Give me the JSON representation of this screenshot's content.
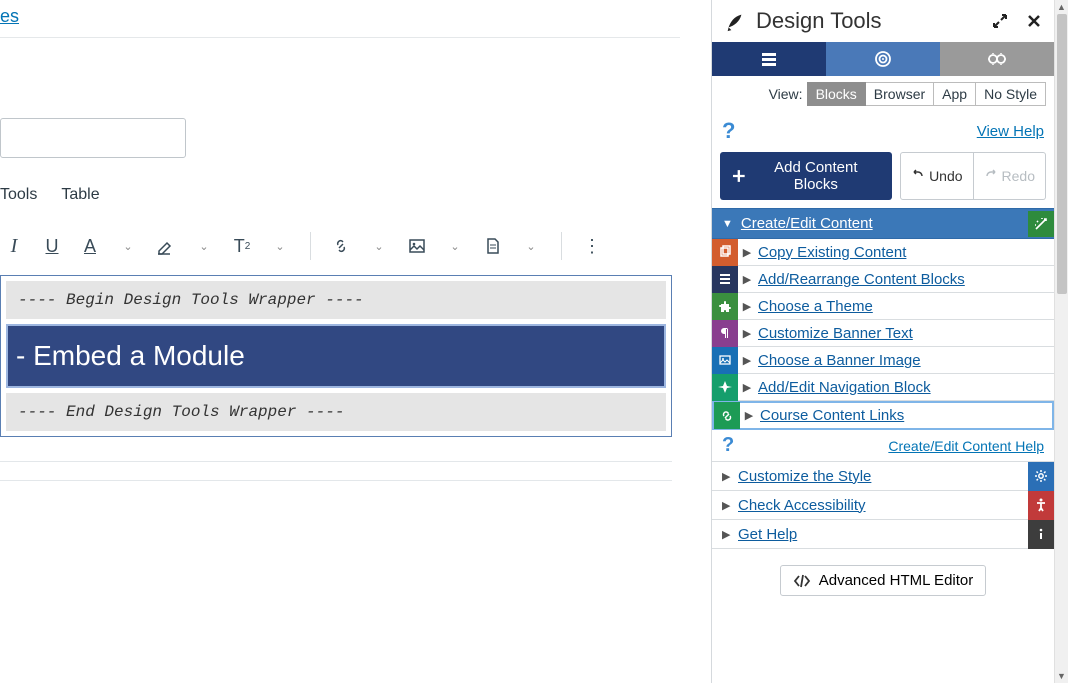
{
  "editor": {
    "top_link": "es",
    "menu": {
      "tools": "Tools",
      "table": "Table"
    },
    "wrapper_begin": " ---- Begin Design Tools Wrapper ---- ",
    "wrapper_end": " ---- End Design Tools Wrapper ---- ",
    "module_banner": "- Embed a Module"
  },
  "panel": {
    "title": "Design Tools",
    "view_label": "View:",
    "view_options": [
      "Blocks",
      "Browser",
      "App",
      "No Style"
    ],
    "view_selected_index": 0,
    "view_help": "View Help",
    "add_blocks": "Add Content Blocks",
    "undo": "Undo",
    "redo": "Redo",
    "section_create": "Create/Edit Content",
    "create_items": [
      {
        "label": "Copy Existing Content",
        "color": "orange",
        "icon": "copy"
      },
      {
        "label": "Add/Rearrange Content Blocks",
        "color": "navy",
        "icon": "list"
      },
      {
        "label": "Choose a Theme",
        "color": "green",
        "icon": "puzzle"
      },
      {
        "label": "Customize Banner Text",
        "color": "purple",
        "icon": "paragraph"
      },
      {
        "label": "Choose a Banner Image",
        "color": "blue",
        "icon": "image"
      },
      {
        "label": "Add/Edit Navigation Block",
        "color": "teal",
        "icon": "compass"
      },
      {
        "label": "Course Content Links",
        "color": "emerald",
        "icon": "link",
        "selected": true
      }
    ],
    "create_help": "Create/Edit Content Help",
    "plain_items": [
      {
        "label": "Customize the Style",
        "side_color": "blue2",
        "side_icon": "gear"
      },
      {
        "label": "Check Accessibility",
        "side_color": "red",
        "side_icon": "access"
      },
      {
        "label": "Get Help",
        "side_color": "dark",
        "side_icon": "info"
      }
    ],
    "advanced_editor": "Advanced HTML Editor"
  }
}
